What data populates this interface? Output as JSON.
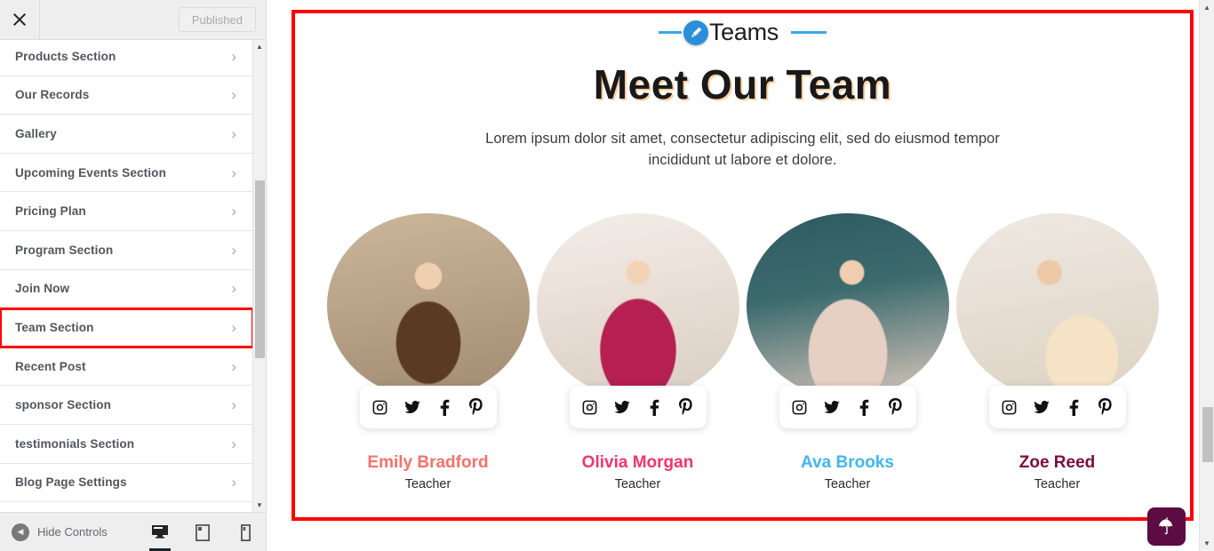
{
  "customizer": {
    "close_icon": "close-icon",
    "published_label": "Published",
    "items": [
      {
        "label": "Products Section",
        "chevron": "›"
      },
      {
        "label": "Our Records",
        "chevron": "›"
      },
      {
        "label": "Gallery",
        "chevron": "›"
      },
      {
        "label": "Upcoming Events Section",
        "chevron": "›"
      },
      {
        "label": "Pricing Plan",
        "chevron": "›"
      },
      {
        "label": "Program Section",
        "chevron": "›"
      },
      {
        "label": "Join Now",
        "chevron": "›"
      },
      {
        "label": "Team Section",
        "chevron": "›"
      },
      {
        "label": "Recent Post",
        "chevron": "›"
      },
      {
        "label": "sponsor Section",
        "chevron": "›"
      },
      {
        "label": "testimonials Section",
        "chevron": "›"
      },
      {
        "label": "Blog Page Settings",
        "chevron": "›"
      }
    ],
    "highlighted_item": "Team Section",
    "scroll_up_arrow": "▲",
    "scroll_down_arrow": "▼",
    "footer": {
      "hide_controls_label": "Hide Controls",
      "collapse_icon": "◀",
      "devices": [
        {
          "name": "desktop",
          "active": true
        },
        {
          "name": "tablet",
          "active": false
        },
        {
          "name": "mobile",
          "active": false
        }
      ]
    }
  },
  "preview": {
    "highlight_color": "#ff0000",
    "section_badge": {
      "icon": "pencil-edit-icon",
      "text": "Teams",
      "accent": "#3ba7e8"
    },
    "heading": "Meet Our Team",
    "description": "Lorem ipsum dolor sit amet, consectetur adipiscing elit, sed do eiusmod tempor incididunt ut labore et dolore.",
    "social_icons": [
      "instagram-icon",
      "twitter-icon",
      "facebook-icon",
      "pinterest-icon"
    ],
    "members": [
      {
        "name": "Emily Bradford",
        "role": "Teacher",
        "color": "#f4726a"
      },
      {
        "name": "Olivia Morgan",
        "role": "Teacher",
        "color": "#f0356f"
      },
      {
        "name": "Ava Brooks",
        "role": "Teacher",
        "color": "#41b6f0"
      },
      {
        "name": "Zoe Reed",
        "role": "Teacher",
        "color": "#7b0d3e"
      }
    ],
    "fab": {
      "icon": "umbrella-icon",
      "color": "#5c0b43"
    }
  },
  "window_scroll": {
    "up_arrow": "▲",
    "down_arrow": "▼"
  }
}
